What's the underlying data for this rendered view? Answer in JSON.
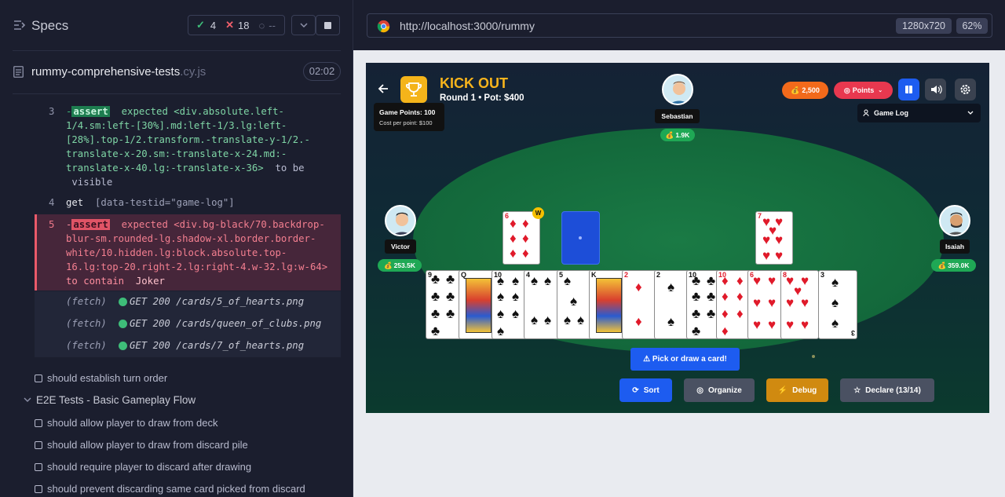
{
  "left_panel": {
    "title": "Specs",
    "stats": {
      "passed": "4",
      "failed": "18",
      "pending": "--"
    },
    "spec_file": {
      "name": "rummy-comprehensive-tests",
      "ext": ".cy.js",
      "duration": "02:02"
    },
    "commands": [
      {
        "num": "3",
        "prefix": "-",
        "badge": "assert",
        "text": "expected <div.absolute.left-\n1/4.sm:left-[30%].md:left-1/3.lg:left-\n[28%].top-1/2.transform.-translate-y-1/2.-\ntranslate-x-20.sm:-translate-x-24.md:-\ntranslate-x-40.lg:-translate-x-36>",
        "tail": "to be",
        "tail2": "visible"
      },
      {
        "num": "4",
        "name": "get",
        "arg": "[data-testid=\"game-log\"]"
      },
      {
        "num": "5",
        "prefix": "-",
        "badge": "assert",
        "text": "expected <div.bg-black/70.backdrop-\nblur-sm.rounded-lg.shadow-xl.border.border-\nwhite/10.hidden.lg:block.absolute.top-\n16.lg:top-20.right-2.lg:right-4.w-32.lg:w-64>",
        "tail": "to contain",
        "tail2": "Joker"
      }
    ],
    "fetches": [
      {
        "label": "(fetch)",
        "req": "GET 200 /cards/5_of_hearts.png"
      },
      {
        "label": "(fetch)",
        "req": "GET 200 /cards/queen_of_clubs.png"
      },
      {
        "label": "(fetch)",
        "req": "GET 200 /cards/7_of_hearts.png"
      }
    ],
    "tests_before": [
      "should establish turn order"
    ],
    "suite": "E2E Tests - Basic Gameplay Flow",
    "tests": [
      "should allow player to draw from deck",
      "should allow player to draw from discard pile",
      "should require player to discard after drawing",
      "should prevent discarding same card picked from discard"
    ]
  },
  "browser": {
    "url": "http://localhost:3000/rummy",
    "viewport": "1280x720",
    "zoom": "62%"
  },
  "game": {
    "title": "KICK OUT",
    "subtitle": "Round 1 • Pot: $400",
    "tooltip_line1": "Game Points: 100",
    "tooltip_line2": "Cost per point: $100",
    "coins": "2,500",
    "points_label": "Points",
    "game_log": "Game Log",
    "wild_badge": "W",
    "players": {
      "top": {
        "name": "Sebastian",
        "money": "1.9K"
      },
      "left": {
        "name": "Victor",
        "money": "253.5K"
      },
      "right": {
        "name": "Isaiah",
        "money": "359.0K"
      }
    },
    "hand": [
      "9♣",
      "Q♣",
      "10♠",
      "4♠",
      "5♠",
      "K♣",
      "2♦",
      "2♠",
      "10♣",
      "10♦",
      "6♥",
      "8♥",
      "3♠"
    ],
    "prompt": "⚠ Pick or draw a card!",
    "actions": {
      "sort": "Sort",
      "organize": "Organize",
      "debug": "Debug",
      "declare": "Declare (13/14)"
    },
    "colors": {
      "coins": "#f26a1b",
      "points": "#e8384f",
      "accent_blue": "#1d5cf0",
      "debug": "#d08a10",
      "felt": "#13683b"
    }
  }
}
